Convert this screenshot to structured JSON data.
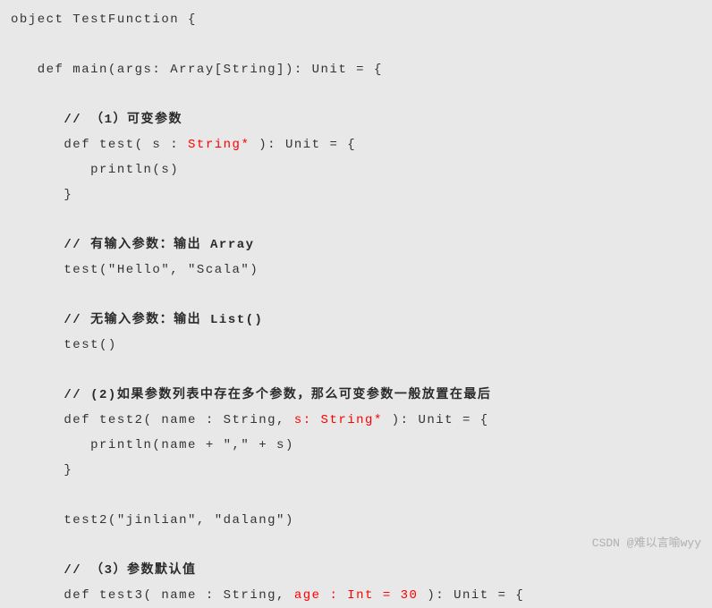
{
  "code": {
    "l1": "object TestFunction {",
    "l2": "   def main(args: Array[String]): Unit = {",
    "c1_prefix": "      // （1）",
    "c1_bold": "可变参数",
    "l4": "      def test( s : ",
    "l4_red": "String*",
    "l4_suffix": " ): Unit = {",
    "l5": "         println(s)",
    "l6": "      }",
    "c2": "      // 有输入参数：输出 Array",
    "l8": "      test(\"Hello\", \"Scala\")",
    "c3": "      // 无输入参数：输出 List()",
    "l10": "      test()",
    "c4_prefix": "      // (2)如果参数列表中存在多个参数，那么",
    "c4_red": "可变参数一般放置在最后",
    "l12": "      def test2( name : String, ",
    "l12_red": "s: String*",
    "l12_suffix": " ): Unit = {",
    "l13": "         println(name + \",\" + s)",
    "l14": "      }",
    "l15": "      test2(\"jinlian\", \"dalang\")",
    "c5_prefix": "      // （3）",
    "c5_bold": "参数默认值",
    "l17": "      def test3( name : String, ",
    "l17_red": "age : Int = 30",
    "l17_suffix": " ): Unit = {"
  },
  "watermark": "CSDN @难以言喻wyy"
}
